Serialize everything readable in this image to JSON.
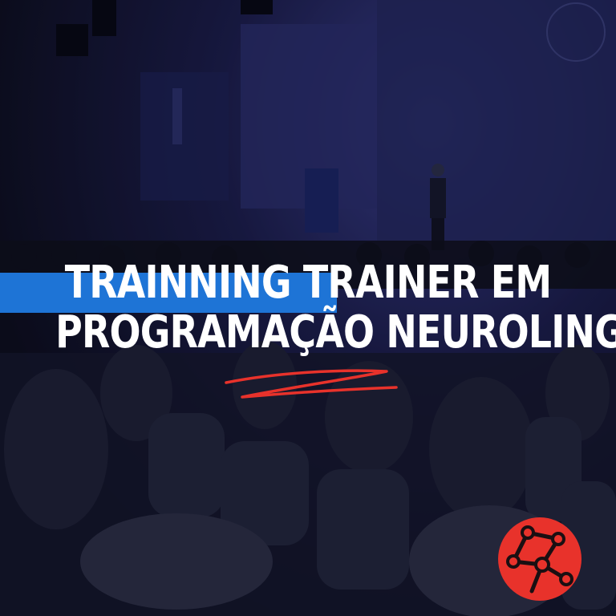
{
  "headline": {
    "line1": "TRAINNING TRAINER EM",
    "line2": "PROGRAMAÇÃO NEUROLINGUÍSTICA"
  },
  "colors": {
    "accent_blue": "#1e74d6",
    "accent_red": "#e8322b",
    "text": "#ffffff",
    "overlay": "#0b0c1a"
  },
  "icons": {
    "logo": "red-globe-network-icon",
    "scribble": "red-underline-scribble"
  }
}
